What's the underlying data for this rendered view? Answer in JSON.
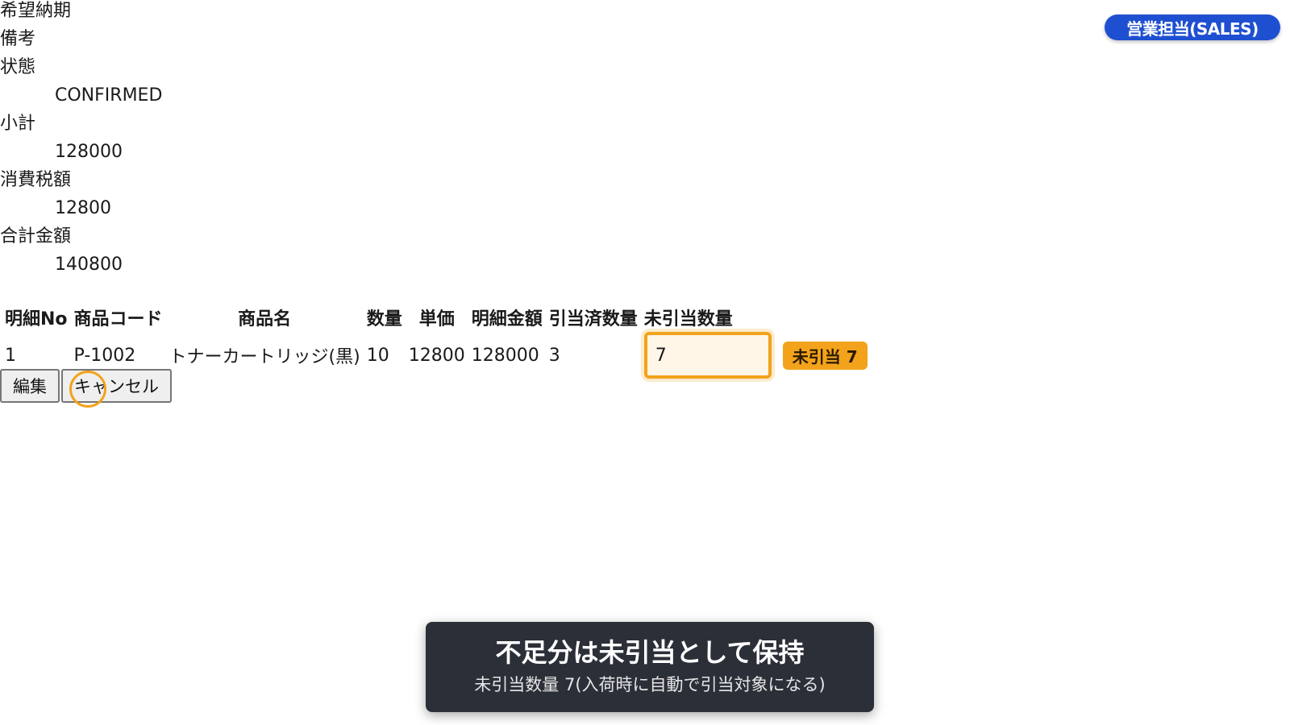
{
  "header": {
    "role_badge": "営業担当(SALES)"
  },
  "order": {
    "fields": [
      {
        "label": "希望納期",
        "value": ""
      },
      {
        "label": "備考",
        "value": ""
      },
      {
        "label": "状態",
        "value": "CONFIRMED"
      },
      {
        "label": "小計",
        "value": "128000"
      },
      {
        "label": "消費税額",
        "value": "12800"
      },
      {
        "label": "合計金額",
        "value": "140800"
      }
    ]
  },
  "lines": {
    "headers": [
      "明細No",
      "商品コード",
      "商品名",
      "数量",
      "単価",
      "明細金額",
      "引当済数量",
      "未引当数量"
    ],
    "rows": [
      {
        "no": "1",
        "code": "P-1002",
        "name": "トナーカートリッジ(黒)",
        "qty": "10",
        "unit_price": "12800",
        "amount": "128000",
        "allocated": "3",
        "unallocated_input": "7",
        "unallocated_badge": "未引当 7"
      }
    ]
  },
  "actions": {
    "edit_label": "編集",
    "cancel_label": "キャンセル"
  },
  "toast": {
    "title": "不足分は未引当として保持",
    "subtitle": "未引当数量 7(入荷時に自動で引当対象になる)"
  },
  "colors": {
    "badge_blue": "#1f4fd1",
    "highlight_orange": "#f2a31b",
    "toast_bg": "#2b2f38"
  }
}
